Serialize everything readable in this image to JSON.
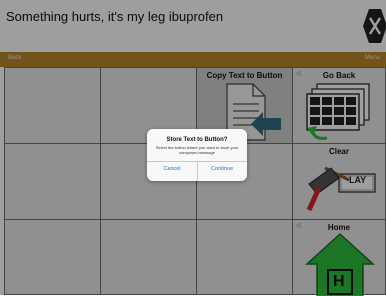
{
  "message_bar": {
    "text": "Something hurts, it's my leg ibuprofen"
  },
  "nav_bar": {
    "back_label": "Back",
    "menu_label": "Menu"
  },
  "buttons": {
    "copy_text": {
      "label": "Copy Text to Button"
    },
    "go_back": {
      "label": "Go Back"
    },
    "clear": {
      "label": "Clear",
      "icon_text": "LAY"
    },
    "home": {
      "label": "Home",
      "icon_text": "H"
    }
  },
  "dialog": {
    "title": "Store Text to Button?",
    "message": "Select the button where you want to store your composed message",
    "cancel_label": "Cancel",
    "continue_label": "Continue"
  },
  "colors": {
    "nav_bar": "#b8862d",
    "dialog_link": "#1a6fd6",
    "home_green": "#2fbf3c"
  }
}
